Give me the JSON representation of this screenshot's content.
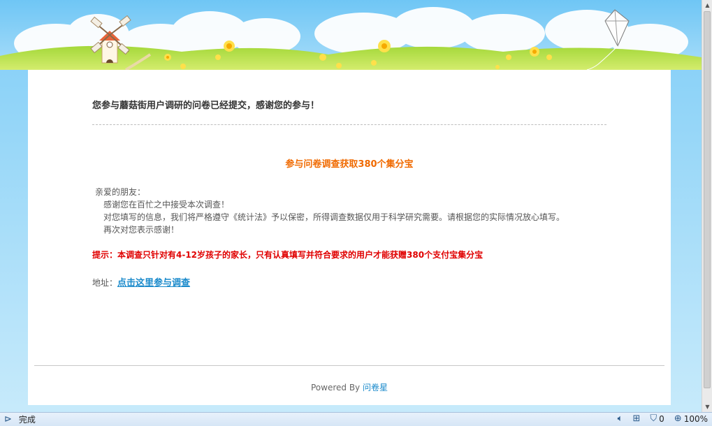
{
  "survey": {
    "title": "您参与蘑菇街用户调研的问卷已经提交，感谢您的参与！",
    "promo": "参与问卷调查获取380个集分宝",
    "letter": [
      "亲爱的朋友：",
      "感谢您在百忙之中接受本次调查！",
      "对您填写的信息，我们将严格遵守《统计法》予以保密，所得调查数据仅用于科学研究需要。请根据您的实际情况放心填写。",
      "再次对您表示感谢！"
    ],
    "tip": "提示：本调查只针对有4-12岁孩子的家长，只有认真填写并符合要求的用户才能获赠380个支付宝集分宝",
    "address_label": "地址：",
    "address_link": "点击这里参与调查"
  },
  "footer": {
    "powered_by": "Powered By",
    "brand": "问卷星"
  },
  "statusbar": {
    "status": "完成",
    "popup_count": "0",
    "zoom": "100%"
  },
  "colors": {
    "promo": "#f06a00",
    "tip": "#e00000",
    "link": "#1a8acb"
  }
}
